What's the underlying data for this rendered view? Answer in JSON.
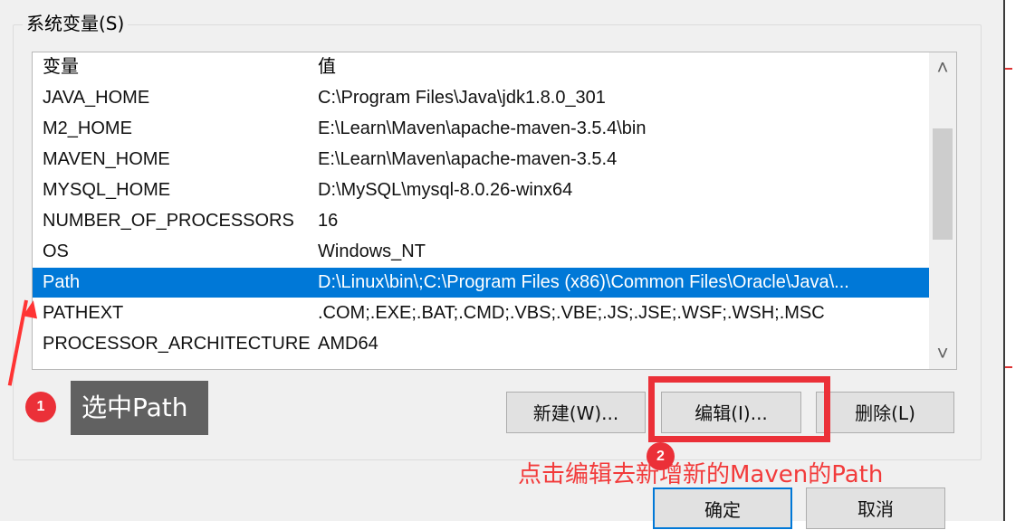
{
  "dialog": {
    "group_title": "系统变量(S)"
  },
  "system_variables": {
    "columns": [
      "变量",
      "值"
    ],
    "rows": [
      {
        "name": "JAVA_HOME",
        "value": "C:\\Program Files\\Java\\jdk1.8.0_301"
      },
      {
        "name": "M2_HOME",
        "value": "E:\\Learn\\Maven\\apache-maven-3.5.4\\bin"
      },
      {
        "name": "MAVEN_HOME",
        "value": "E:\\Learn\\Maven\\apache-maven-3.5.4"
      },
      {
        "name": "MYSQL_HOME",
        "value": "D:\\MySQL\\mysql-8.0.26-winx64"
      },
      {
        "name": "NUMBER_OF_PROCESSORS",
        "value": "16"
      },
      {
        "name": "OS",
        "value": "Windows_NT"
      },
      {
        "name": "Path",
        "value": "D:\\Linux\\bin\\;C:\\Program Files (x86)\\Common Files\\Oracle\\Java\\..."
      },
      {
        "name": "PATHEXT",
        "value": ".COM;.EXE;.BAT;.CMD;.VBS;.VBE;.JS;.JSE;.WSF;.WSH;.MSC"
      },
      {
        "name": "PROCESSOR_ARCHITECTURE",
        "value": "AMD64"
      }
    ],
    "selected_row": "Path"
  },
  "scrollbar": {
    "up_icon": "chevron-up-icon",
    "down_icon": "chevron-down-icon",
    "up_glyph": "˄",
    "down_glyph": "˅"
  },
  "buttons": {
    "new_label": "新建(W)...",
    "edit_label": "编辑(I)...",
    "delete_label": "删除(L)",
    "ok_label": "确定",
    "cancel_label": "取消"
  },
  "annotations": {
    "step_1": "1",
    "tooltip_1": "选中Path",
    "step_2": "2",
    "instruction": "点击编辑去新增新的Maven的Path"
  },
  "colors": {
    "selection": "#0078d7",
    "annotation_red": "#eb3038",
    "tooltip_gray": "#616161"
  }
}
